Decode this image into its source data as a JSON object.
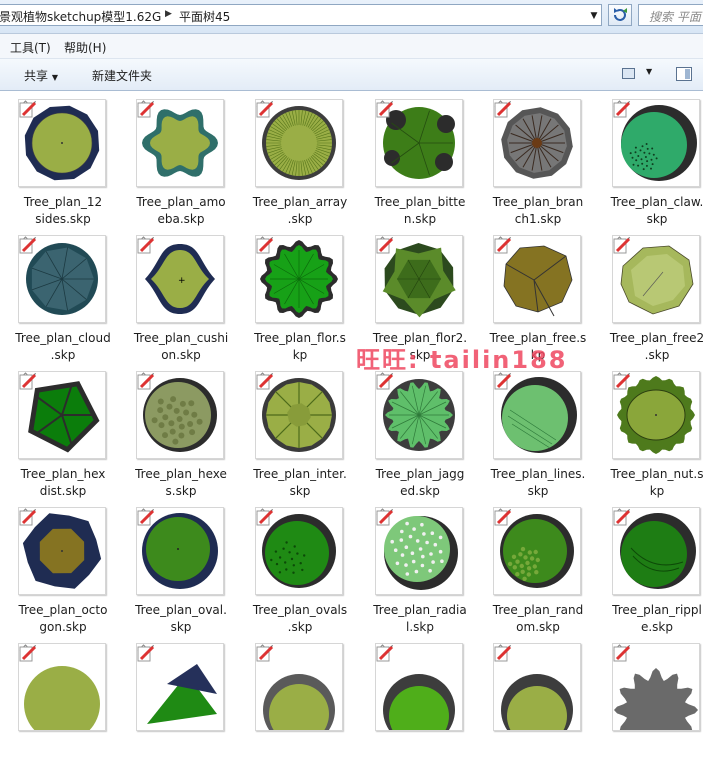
{
  "address": {
    "segments": [
      "景观植物sketchup模型1.62G",
      "平面树45"
    ],
    "search_placeholder": "搜索 平面"
  },
  "menu": {
    "items": [
      "工具(T)",
      "帮助(H)"
    ]
  },
  "toolbar": {
    "share_label": "共享",
    "new_folder_label": "新建文件夹"
  },
  "watermark": "旺旺: tailin188",
  "files": [
    {
      "name_line1": "Tree_plan_12",
      "name_line2": "sides.skp",
      "kind": "12sides"
    },
    {
      "name_line1": "Tree_plan_amo",
      "name_line2": "eba.skp",
      "kind": "amoeba"
    },
    {
      "name_line1": "Tree_plan_array",
      "name_line2": ".skp",
      "kind": "array"
    },
    {
      "name_line1": "Tree_plan_bitte",
      "name_line2": "n.skp",
      "kind": "bitten"
    },
    {
      "name_line1": "Tree_plan_bran",
      "name_line2": "ch1.skp",
      "kind": "branch"
    },
    {
      "name_line1": "Tree_plan_claw.",
      "name_line2": "skp",
      "kind": "claw"
    },
    {
      "name_line1": "Tree_plan_cloud",
      "name_line2": ".skp",
      "kind": "cloud"
    },
    {
      "name_line1": "Tree_plan_cushi",
      "name_line2": "on.skp",
      "kind": "cushion"
    },
    {
      "name_line1": "Tree_plan_flor.s",
      "name_line2": "kp",
      "kind": "flor"
    },
    {
      "name_line1": "Tree_plan_flor2.",
      "name_line2": "skp",
      "kind": "flor2"
    },
    {
      "name_line1": "Tree_plan_free.s",
      "name_line2": "kp",
      "kind": "free"
    },
    {
      "name_line1": "Tree_plan_free2",
      "name_line2": ".skp",
      "kind": "free2"
    },
    {
      "name_line1": "Tree_plan_hex",
      "name_line2": "dist.skp",
      "kind": "hexdist"
    },
    {
      "name_line1": "Tree_plan_hexe",
      "name_line2": "s.skp",
      "kind": "hexes"
    },
    {
      "name_line1": "Tree_plan_inter.",
      "name_line2": "skp",
      "kind": "inter"
    },
    {
      "name_line1": "Tree_plan_jagg",
      "name_line2": "ed.skp",
      "kind": "jagged"
    },
    {
      "name_line1": "Tree_plan_lines.",
      "name_line2": "skp",
      "kind": "lines"
    },
    {
      "name_line1": "Tree_plan_nut.s",
      "name_line2": "kp",
      "kind": "nut"
    },
    {
      "name_line1": "Tree_plan_octo",
      "name_line2": "gon.skp",
      "kind": "octagon"
    },
    {
      "name_line1": "Tree_plan_oval.",
      "name_line2": "skp",
      "kind": "oval"
    },
    {
      "name_line1": "Tree_plan_ovals",
      "name_line2": ".skp",
      "kind": "ovals"
    },
    {
      "name_line1": "Tree_plan_radia",
      "name_line2": "l.skp",
      "kind": "radial"
    },
    {
      "name_line1": "Tree_plan_rand",
      "name_line2": "om.skp",
      "kind": "random"
    },
    {
      "name_line1": "Tree_plan_rippl",
      "name_line2": "e.skp",
      "kind": "ripple"
    },
    {
      "name_line1": "",
      "name_line2": "",
      "kind": "p1"
    },
    {
      "name_line1": "",
      "name_line2": "",
      "kind": "p2"
    },
    {
      "name_line1": "",
      "name_line2": "",
      "kind": "p3"
    },
    {
      "name_line1": "",
      "name_line2": "",
      "kind": "p4"
    },
    {
      "name_line1": "",
      "name_line2": "",
      "kind": "p5"
    },
    {
      "name_line1": "",
      "name_line2": "",
      "kind": "p6"
    }
  ],
  "colors": {
    "navy": "#1f2c52",
    "olive": "#9aae46",
    "green": "#3a8a1c",
    "bright": "#17a117",
    "dark": "#2c2c2c",
    "mint": "#2faa6a",
    "teal": "#3b6470",
    "ochre": "#857322"
  }
}
